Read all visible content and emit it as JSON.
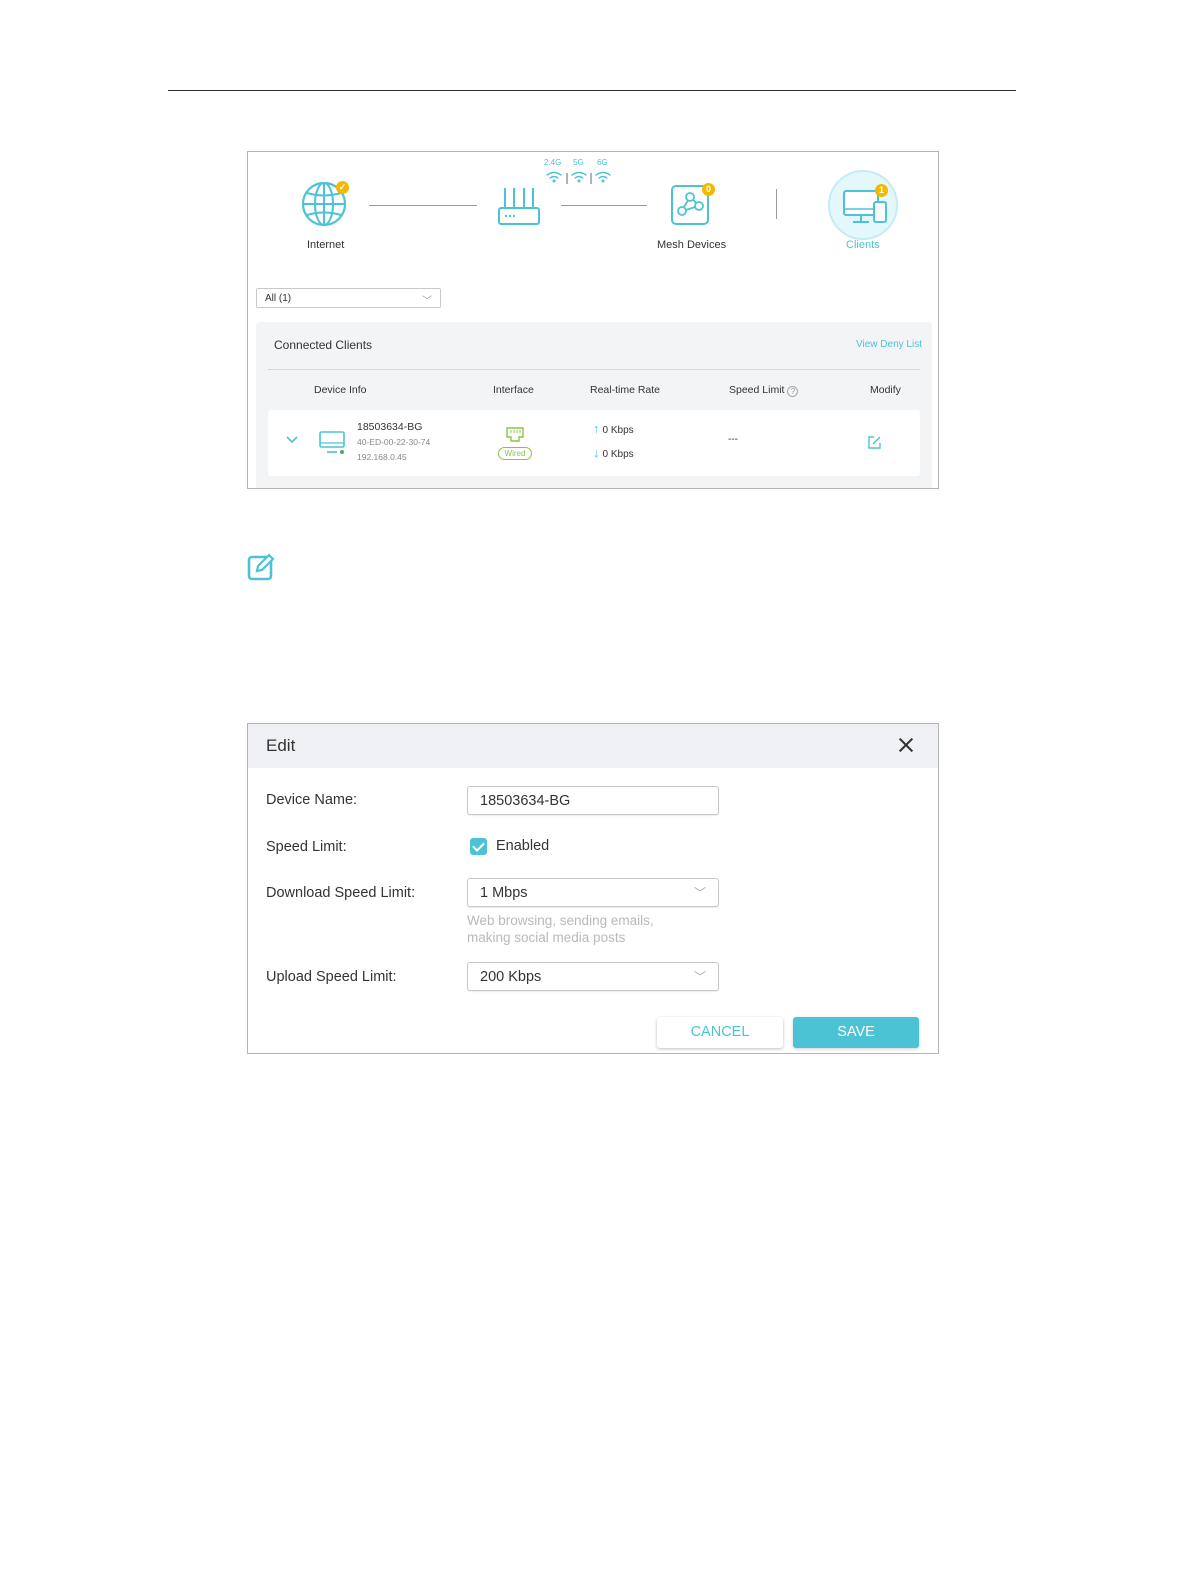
{
  "network_map": {
    "bands": [
      "2.4G",
      "5G",
      "6G"
    ],
    "internet_label": "Internet",
    "mesh_label": "Mesh Devices",
    "mesh_badge": "0",
    "clients_label": "Clients",
    "clients_badge": "1"
  },
  "filter": {
    "value": "All (1)"
  },
  "clients": {
    "title": "Connected Clients",
    "deny_link": "View Deny List",
    "columns": {
      "device": "Device Info",
      "interface": "Interface",
      "rate": "Real-time Rate",
      "speed": "Speed Limit",
      "modify": "Modify"
    },
    "rows": [
      {
        "name": "18503634-BG",
        "mac": "40-ED-00-22-30-74",
        "ip": "192.168.0.45",
        "interface": "Wired",
        "up": "0 Kbps",
        "down": "0 Kbps",
        "speed_limit": "---"
      }
    ]
  },
  "edit_dialog": {
    "title": "Edit",
    "device_name_label": "Device Name:",
    "device_name_value": "18503634-BG",
    "speed_limit_label": "Speed Limit:",
    "enabled_label": "Enabled",
    "download_label": "Download Speed Limit:",
    "download_value": "1 Mbps",
    "download_hint": "Web browsing, sending emails, making social media posts",
    "upload_label": "Upload Speed Limit:",
    "upload_value": "200 Kbps",
    "cancel": "CANCEL",
    "save": "SAVE"
  },
  "colors": {
    "accent": "#4cc3d5",
    "badge": "#f5b800",
    "wired": "#8bc34a"
  }
}
